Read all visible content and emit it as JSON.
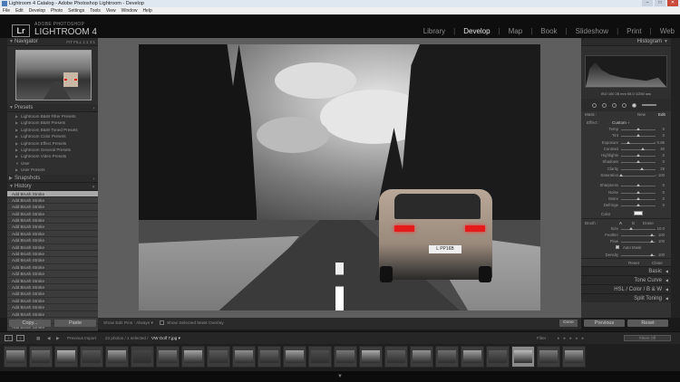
{
  "window": {
    "title": "Lightroom 4 Catalog - Adobe Photoshop Lightroom - Develop",
    "min_btn": "–",
    "max_btn": "□",
    "close_btn": "✕"
  },
  "menu": [
    "File",
    "Edit",
    "Develop",
    "Photo",
    "Settings",
    "Tools",
    "View",
    "Window",
    "Help"
  ],
  "identity": {
    "logo": "Lr",
    "small": "ADOBE PHOTOSHOP",
    "big": "LIGHTROOM 4"
  },
  "modules": [
    "Library",
    "Develop",
    "Map",
    "Book",
    "Slideshow",
    "Print",
    "Web"
  ],
  "active_module": "Develop",
  "left": {
    "navigator_title": "Navigator",
    "navigator_zoom": "FIT  FILL  1:1  3:1",
    "presets_title": "Presets",
    "presets": [
      "Lightroom B&W Filter Presets",
      "Lightroom B&W Presets",
      "Lightroom B&W Toned Presets",
      "Lightroom Color Presets",
      "Lightroom Effect Presets",
      "Lightroom General Presets",
      "Lightroom Video Presets",
      "User",
      "User Presets"
    ],
    "snapshots_title": "Snapshots",
    "history_title": "History",
    "history_clear": "✕",
    "history": [
      "Add Brush Stroke",
      "Add Brush Stroke",
      "Add Brush Stroke",
      "Add Brush Stroke",
      "Add Brush Stroke",
      "Add Brush Stroke",
      "Add Brush Stroke",
      "Add Brush Stroke",
      "Add Brush Stroke",
      "Add Brush Stroke",
      "Add Brush Stroke",
      "Add Brush Stroke",
      "Add Brush Stroke",
      "Add Brush Stroke",
      "Add Brush Stroke",
      "Add Brush Stroke",
      "Add Brush Stroke",
      "Add Brush Stroke",
      "Add Brush Stroke",
      "Add Brush Stroke",
      "Add Brush Stroke",
      "Add Brush Stroke",
      "Add Brush Stroke",
      "Add Brush Stroke",
      "Add Brush Stroke"
    ],
    "copy_btn": "Copy...",
    "paste_btn": "Paste"
  },
  "center": {
    "plate": "L PP16B",
    "show_edit_pins_label": "Show Edit Pins :",
    "show_edit_pins_value": "Always ▾",
    "overlay_label": "Show Selected Mask Overlay",
    "done_btn": "Done"
  },
  "right": {
    "histogram_title": "Histogram",
    "histo_info": "ISO 100   28 mm   f/8.0   1/250 sec",
    "mask_label": "Mask :",
    "mask_new": "New",
    "mask_edit": "Edit",
    "effect_label": "Effect :",
    "effect_value": "Custom ÷",
    "adjustments": [
      {
        "label": "Temp",
        "pos": 0.5,
        "value": "0"
      },
      {
        "label": "Tint",
        "pos": 0.5,
        "value": "0"
      },
      {
        "label": "Exposure",
        "pos": 0.2,
        "value": "− 0.86"
      },
      {
        "label": "Contrast",
        "pos": 0.62,
        "value": "30"
      },
      {
        "label": "Highlights",
        "pos": 0.5,
        "value": "0"
      },
      {
        "label": "Shadows",
        "pos": 0.5,
        "value": "0"
      },
      {
        "label": "Clarity",
        "pos": 0.6,
        "value": "29"
      },
      {
        "label": "Saturation",
        "pos": 0.0,
        "value": "− 100"
      },
      {
        "label": "Sharpness",
        "pos": 0.5,
        "value": "0"
      },
      {
        "label": "Noise",
        "pos": 0.5,
        "value": "0"
      },
      {
        "label": "Moire",
        "pos": 0.5,
        "value": "0"
      },
      {
        "label": "Defringe",
        "pos": 0.5,
        "value": "0"
      }
    ],
    "color_label": "Color",
    "brush_label": "Brush :",
    "brush_a": "A",
    "brush_b": "B",
    "brush_erase": "Erase",
    "brush_settings": [
      {
        "label": "Size",
        "pos": 0.3,
        "value": "10.0"
      },
      {
        "label": "Feather",
        "pos": 0.9,
        "value": "100"
      },
      {
        "label": "Flow",
        "pos": 0.9,
        "value": "100"
      }
    ],
    "auto_mask_label": "Auto Mask",
    "density": {
      "label": "Density",
      "pos": 0.9,
      "value": "100"
    },
    "reset_btn": "Reset",
    "close_btn": "Close",
    "sections": [
      "Basic",
      "Tone Curve",
      "HSL / Color / B & W",
      "Split Toning"
    ],
    "previous_btn": "Previous",
    "reset_btn2": "Reset"
  },
  "filmstrip": {
    "mon1": "1",
    "mon2": "2",
    "source": "Previous Import",
    "count": "23 photos / 1 selected /",
    "filename": "VW Golf 7.jpg ▾",
    "filter_label": "Filter :",
    "stars": "★ ★ ★ ★ ★",
    "filter_value": "Filters Off",
    "thumb_count": 23,
    "selected_index": 20
  },
  "colors": {
    "accent_red": "#e41b1b",
    "panel": "#333333",
    "background": "#1a1a1a"
  }
}
